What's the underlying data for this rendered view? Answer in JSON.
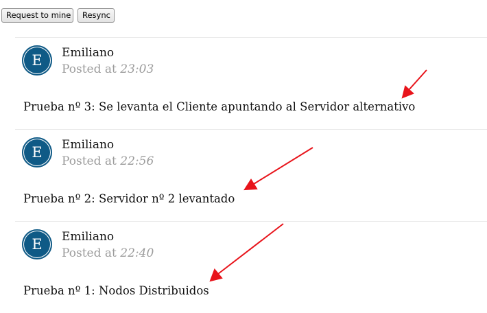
{
  "toolbar": {
    "request_label": "Request to mine",
    "resync_label": "Resync"
  },
  "posts": [
    {
      "avatar_letter": "E",
      "author": "Emiliano",
      "posted_prefix": "Posted at",
      "time": "23:03",
      "message": "Prueba nº 3: Se levanta el Cliente apuntando al Servidor alternativo"
    },
    {
      "avatar_letter": "E",
      "author": "Emiliano",
      "posted_prefix": "Posted at",
      "time": "22:56",
      "message": "Prueba nº 2: Servidor nº 2 levantado"
    },
    {
      "avatar_letter": "E",
      "author": "Emiliano",
      "posted_prefix": "Posted at",
      "time": "22:40",
      "message": "Prueba nº 1: Nodos Distribuidos"
    }
  ],
  "colors": {
    "avatar": "#0f5a86",
    "annotation_arrow": "#e8141b",
    "posted_text": "#9b9b9b"
  }
}
